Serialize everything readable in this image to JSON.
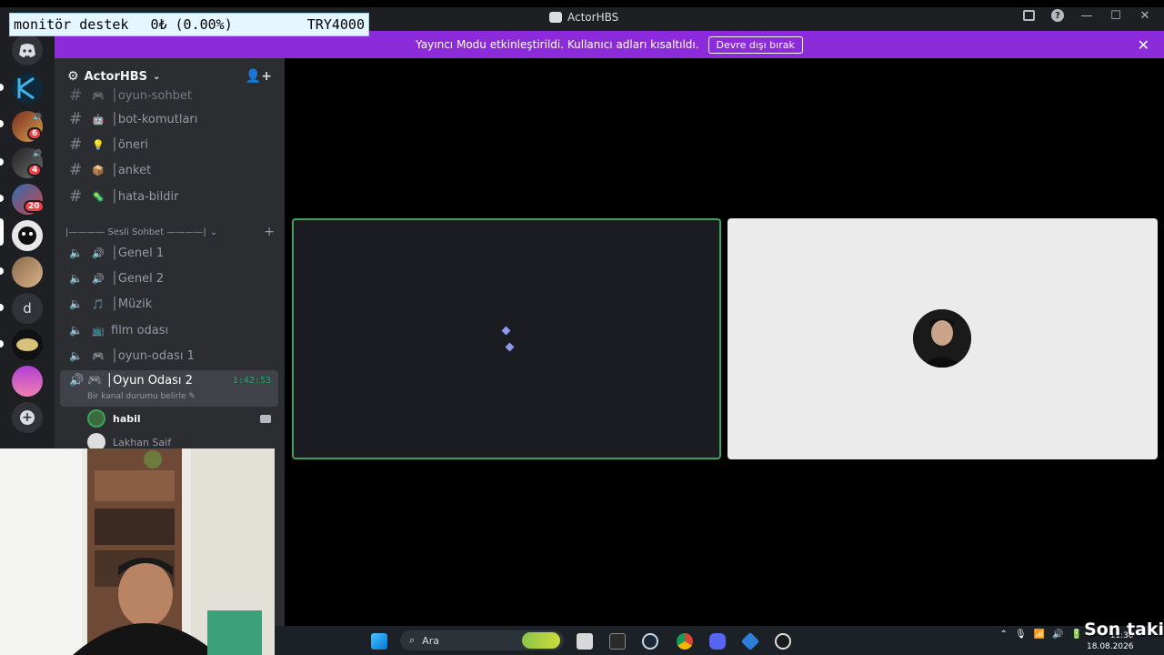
{
  "overlay": {
    "left": "monitör destek",
    "mid": "0₺ (0.00%)",
    "right": "TRY4000"
  },
  "window": {
    "title": "ActorHBS"
  },
  "banner": {
    "text": "Yayıncı Modu etkinleştirildi. Kullanıcı adları kısaltıldı.",
    "button": "Devre dışı bırak"
  },
  "server": {
    "name": "ActorHBS"
  },
  "rail": {
    "badges": [
      "6",
      "4",
      "20"
    ],
    "letter_server": "d"
  },
  "text_channels": [
    {
      "emoji": "🎮",
      "name": "│oyun-sohbet"
    },
    {
      "emoji": "🤖",
      "name": "│bot-komutları"
    },
    {
      "emoji": "💡",
      "name": "│öneri"
    },
    {
      "emoji": "📦",
      "name": "│anket"
    },
    {
      "emoji": "🦠",
      "name": "│hata-bildir"
    }
  ],
  "voice_category": "|———— Sesli Sohbet ————|",
  "voice_channels": [
    {
      "emoji": "🔊",
      "name": "│Genel 1"
    },
    {
      "emoji": "🔊",
      "name": "│Genel 2"
    },
    {
      "emoji": "🎵",
      "name": "│Müzik"
    },
    {
      "emoji": "📺",
      "name": "film odası"
    },
    {
      "emoji": "🎮",
      "name": "│oyun-odası 1"
    }
  ],
  "active_channel": {
    "emoji": "🎮",
    "name": "│Oyun Odası 2",
    "time": "1:42:53",
    "status": "Bir kanal durumu belirle"
  },
  "voice_users": [
    {
      "name": "habil"
    },
    {
      "name": "Lakhan Saif"
    }
  ],
  "taskbar": {
    "search": "Ara",
    "time": "11:30",
    "date": "18.08.2026"
  },
  "watermark": "Son taki",
  "colors": {
    "banner": "#8b2bd9",
    "speaking": "#3ba55d",
    "sidebar": "#2b2d31",
    "rail": "#1e1f22"
  }
}
